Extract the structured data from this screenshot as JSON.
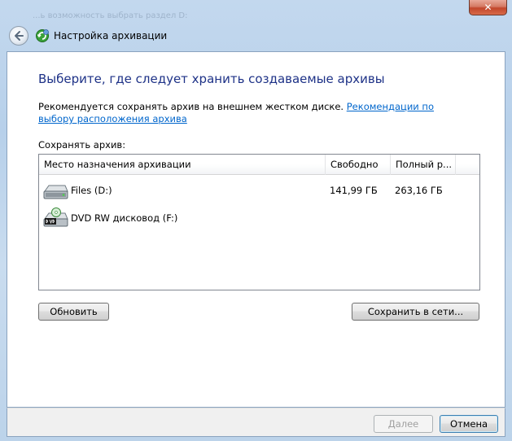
{
  "window": {
    "title": "Настройка архивации",
    "ghost_text": "...ь возможность выбрать раздел D:",
    "close_glyph": "✕"
  },
  "main": {
    "heading": "Выберите, где следует хранить создаваемые архивы",
    "recommend_text": "Рекомендуется сохранять архив на внешнем жестком диске. ",
    "recommend_link": "Рекомендации по выбору расположения архива",
    "save_label": "Сохранять архив:"
  },
  "list": {
    "columns": {
      "name": "Место назначения архивации",
      "free": "Свободно",
      "total": "Полный р...",
      "extra": ""
    },
    "rows": [
      {
        "icon": "hard-drive-icon",
        "name": "Files (D:)",
        "free": "141,99 ГБ",
        "total": "263,16 ГБ"
      },
      {
        "icon": "dvd-drive-icon",
        "name": "DVD RW дисковод (F:)",
        "free": "",
        "total": ""
      }
    ]
  },
  "buttons": {
    "refresh": "Обновить",
    "save_network": "Сохранить в сети...",
    "next": "Далее",
    "cancel": "Отмена"
  },
  "colors": {
    "heading": "#1e3287",
    "link": "#0066cc",
    "frame": "#c3d8ee",
    "close": "#c2462b"
  }
}
